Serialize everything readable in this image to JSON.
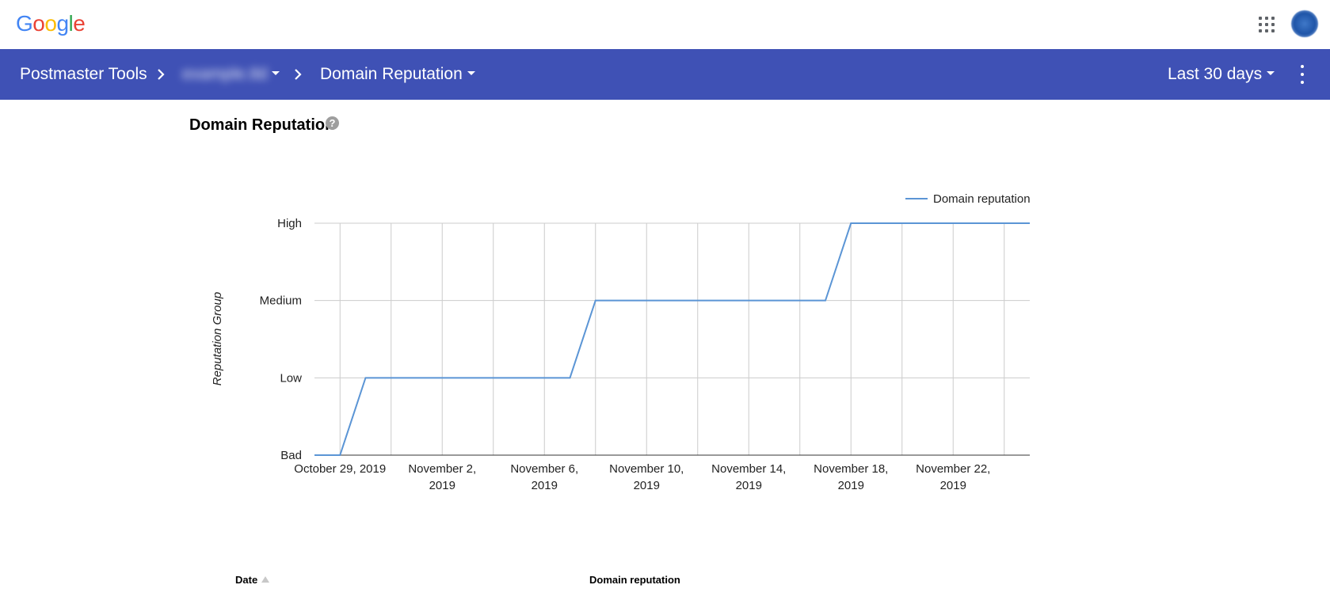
{
  "google_bar": {
    "logo_letters": [
      {
        "ch": "G",
        "color": "#4285F4"
      },
      {
        "ch": "o",
        "color": "#EA4335"
      },
      {
        "ch": "o",
        "color": "#FBBC05"
      },
      {
        "ch": "g",
        "color": "#4285F4"
      },
      {
        "ch": "l",
        "color": "#34A853"
      },
      {
        "ch": "e",
        "color": "#EA4335"
      }
    ],
    "apps_icon": "apps-grid-icon",
    "avatar_icon": "account-avatar"
  },
  "app_bar": {
    "background": "#3f51b5",
    "app_name": "Postmaster Tools",
    "domain_name": "example.tld",
    "section": "Domain Reputation",
    "date_range": "Last 30 days",
    "breadcrumb_separator_icon": "chevron-right-icon",
    "dropdown_icon": "caret-down-icon",
    "more_icon": "more-vert-icon"
  },
  "page": {
    "title": "Domain Reputation",
    "help_icon": "help-circle-icon",
    "help_glyph": "?"
  },
  "chart_data": {
    "type": "line",
    "title": "",
    "xlabel": "",
    "ylabel": "Reputation Group",
    "y_categories": [
      "Bad",
      "Low",
      "Medium",
      "High"
    ],
    "x_ticks": [
      "October 29, 2019",
      "November 2, 2019",
      "November 6, 2019",
      "November 10, 2019",
      "November 14, 2019",
      "November 18, 2019",
      "November 22, 2019"
    ],
    "xlim": [
      "2019-10-28",
      "2019-11-25"
    ],
    "grid": true,
    "legend_position": "top-right",
    "series": [
      {
        "name": "Domain reputation",
        "color": "#5b95d5",
        "points": [
          {
            "x": "2019-10-28",
            "y": "Bad"
          },
          {
            "x": "2019-10-29",
            "y": "Bad"
          },
          {
            "x": "2019-10-30",
            "y": "Low"
          },
          {
            "x": "2019-11-07",
            "y": "Low"
          },
          {
            "x": "2019-11-08",
            "y": "Medium"
          },
          {
            "x": "2019-11-17",
            "y": "Medium"
          },
          {
            "x": "2019-11-18",
            "y": "High"
          },
          {
            "x": "2019-11-25",
            "y": "High"
          }
        ]
      }
    ]
  },
  "table": {
    "columns": [
      {
        "label": "Date",
        "sort_icon": "sort-ascending-icon"
      },
      {
        "label": "Domain reputation"
      }
    ]
  }
}
